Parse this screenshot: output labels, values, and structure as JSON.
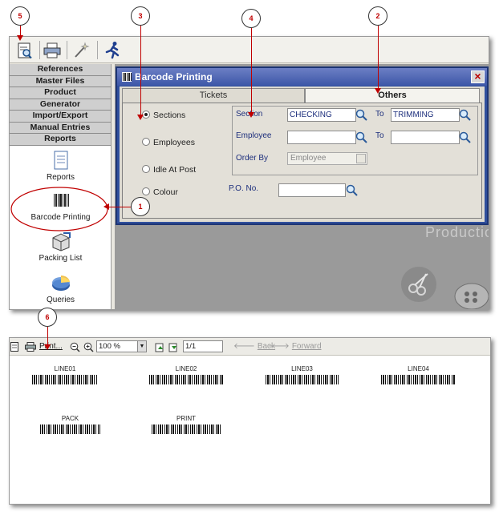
{
  "callouts": [
    "5",
    "3",
    "4",
    "2",
    "1",
    "6"
  ],
  "app": {
    "menu": [
      "References",
      "Master Files",
      "Product",
      "Generator",
      "Import/Export",
      "Manual Entries",
      "Reports"
    ],
    "tools": [
      "Reports",
      "Barcode Printing",
      "Packing List",
      "Queries"
    ],
    "background_text": "Productio"
  },
  "dialog": {
    "title": "Barcode Printing",
    "tabs": [
      "Tickets",
      "Others"
    ],
    "radios": [
      {
        "label": "Sections",
        "checked": true
      },
      {
        "label": "Employees",
        "checked": false
      },
      {
        "label": "Idle At Post",
        "checked": false
      },
      {
        "label": "Colour",
        "checked": false
      }
    ],
    "section_label": "Section",
    "section_from": "CHECKING",
    "to_label": "To",
    "section_to": "TRIMMING",
    "employee_label": "Employee",
    "employee_from": "",
    "employee_to": "",
    "order_by_label": "Order By",
    "order_by_value": "Employee",
    "po_label": "P.O. No.",
    "po_value": ""
  },
  "viewer": {
    "print_label": "Print...",
    "zoom": "100 %",
    "page": "1/1",
    "back_label": "Back",
    "forward_label": "Forward",
    "barcodes": [
      "LINE01",
      "LINE02",
      "LINE03",
      "LINE04",
      "PACK",
      "PRINT"
    ]
  }
}
